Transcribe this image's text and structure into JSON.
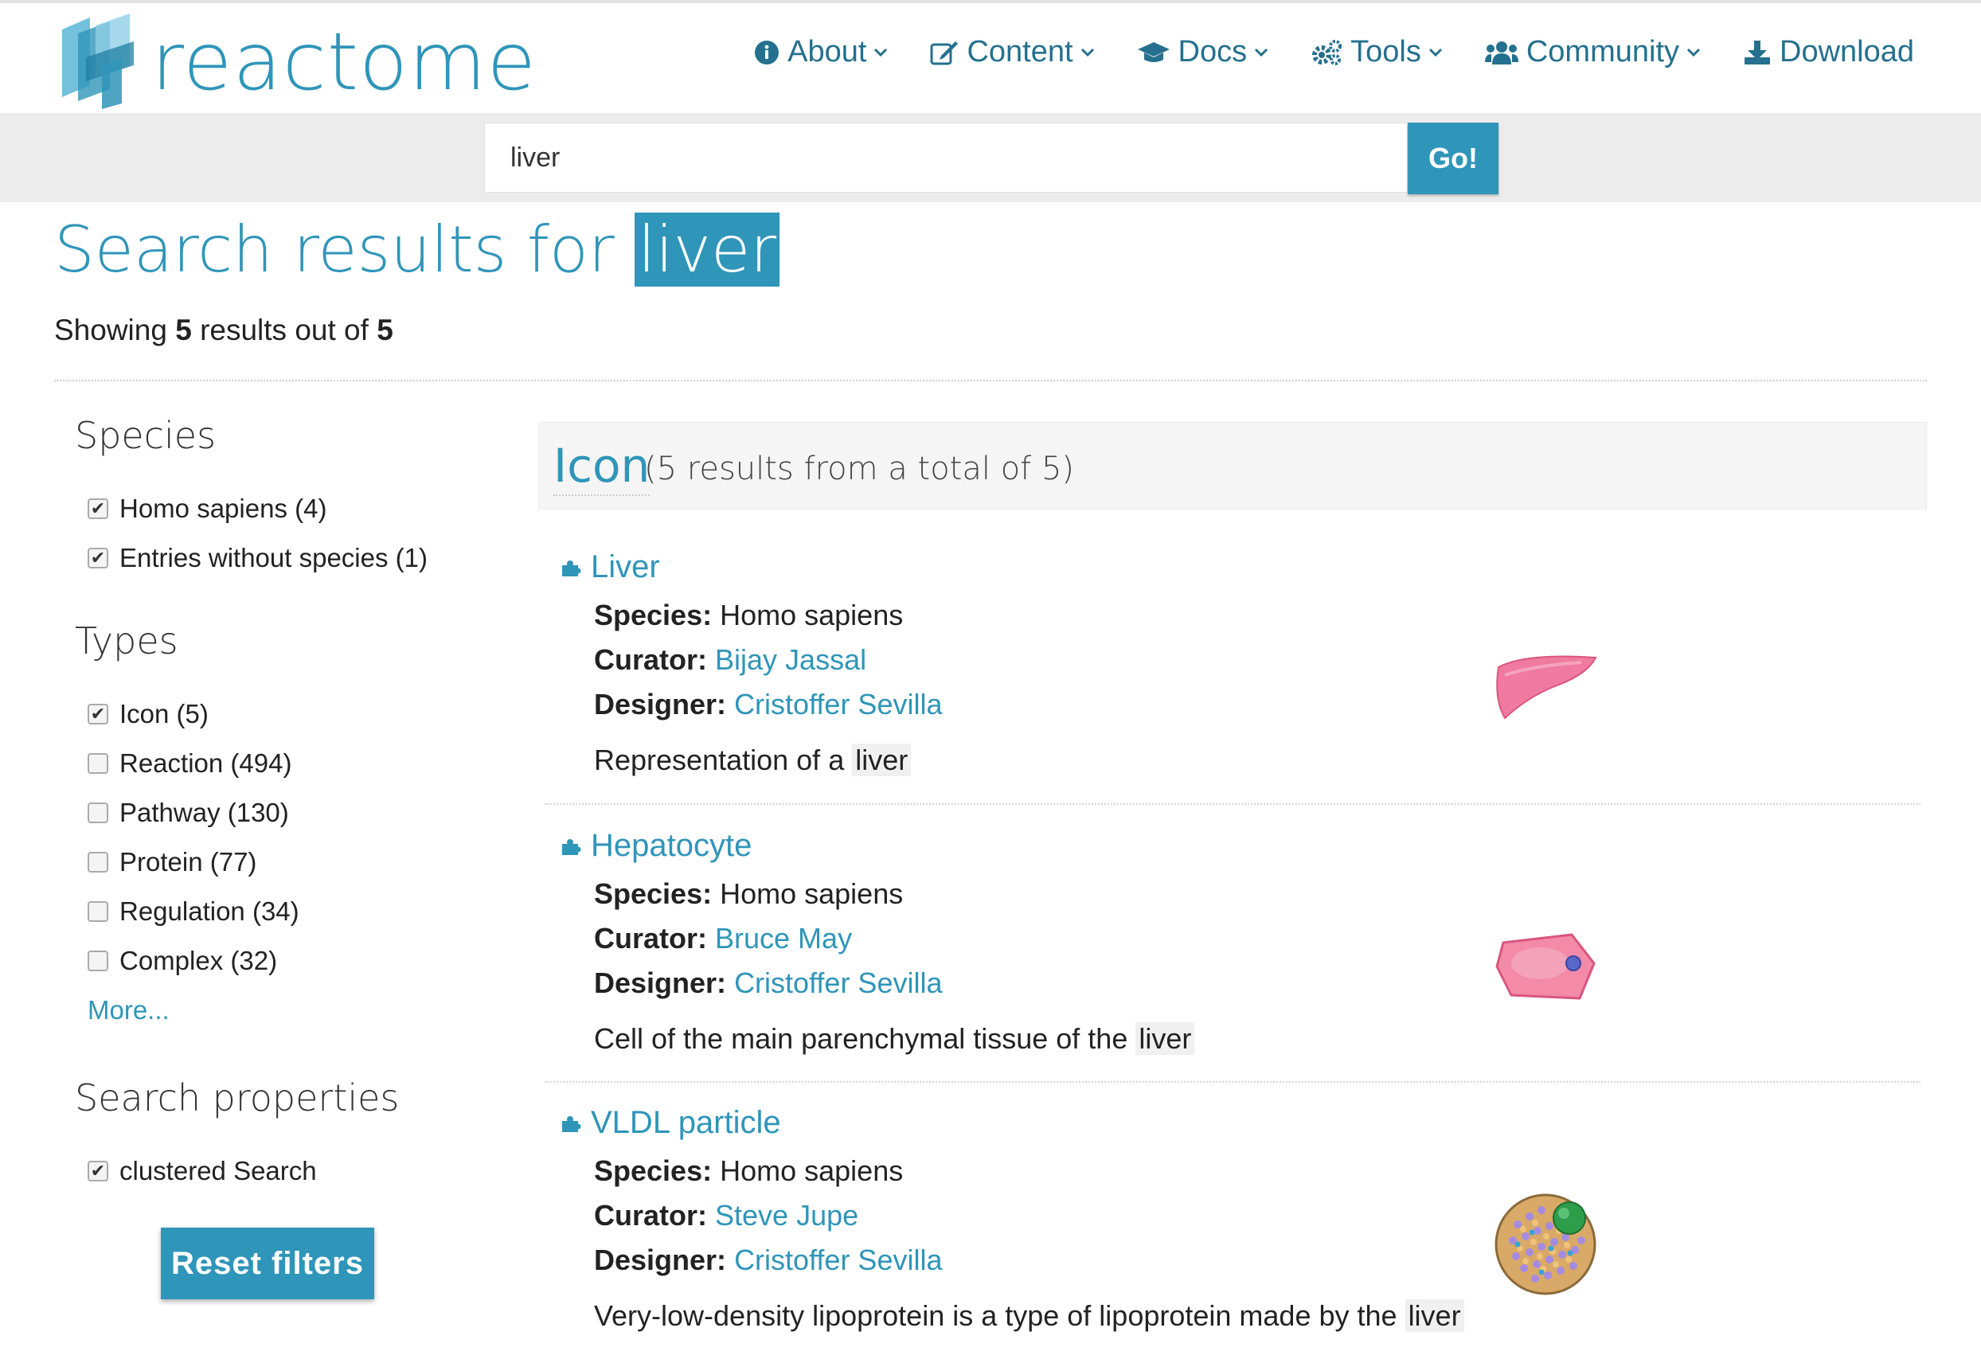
{
  "header": {
    "logo_text": "reactome",
    "nav": [
      {
        "label": "About",
        "icon": "info-circle-icon"
      },
      {
        "label": "Content",
        "icon": "edit-icon"
      },
      {
        "label": "Docs",
        "icon": "graduation-cap-icon"
      },
      {
        "label": "Tools",
        "icon": "cogs-icon"
      },
      {
        "label": "Community",
        "icon": "users-icon"
      },
      {
        "label": "Download",
        "icon": "download-icon"
      }
    ]
  },
  "search": {
    "value": "liver",
    "button_label": "Go!"
  },
  "title": {
    "prefix": "Search results for",
    "query": "liver"
  },
  "showing": {
    "prefix": "Showing",
    "shown": "5",
    "middle": "results out of",
    "total": "5"
  },
  "facets": {
    "species_title": "Species",
    "species": [
      {
        "label": "Homo sapiens (4)",
        "checked": true
      },
      {
        "label": "Entries without species (1)",
        "checked": true
      }
    ],
    "types_title": "Types",
    "types": [
      {
        "label": "Icon (5)",
        "checked": true
      },
      {
        "label": "Reaction (494)",
        "checked": false
      },
      {
        "label": "Pathway (130)",
        "checked": false
      },
      {
        "label": "Protein (77)",
        "checked": false
      },
      {
        "label": "Regulation (34)",
        "checked": false
      },
      {
        "label": "Complex (32)",
        "checked": false
      }
    ],
    "more_label": "More...",
    "props_title": "Search properties",
    "props": [
      {
        "label": "clustered Search",
        "checked": true
      }
    ],
    "reset_label": "Reset filters"
  },
  "results_header": {
    "kind": "Icon",
    "count_text": "(5 results from a total of 5)"
  },
  "labels": {
    "species": "Species:",
    "curator": "Curator:",
    "designer": "Designer:"
  },
  "results": [
    {
      "title": "Liver",
      "species": "Homo sapiens",
      "curator": "Bijay Jassal",
      "designer": "Cristoffer Sevilla",
      "desc_prefix": "Representation of a",
      "desc_highlight": "liver",
      "image": "liver-icon"
    },
    {
      "title": "Hepatocyte",
      "species": "Homo sapiens",
      "curator": "Bruce May",
      "designer": "Cristoffer Sevilla",
      "desc_prefix": "Cell of the main parenchymal tissue of the",
      "desc_highlight": "liver",
      "image": "hepatocyte-icon"
    },
    {
      "title": "VLDL particle",
      "species": "Homo sapiens",
      "curator": "Steve Jupe",
      "designer": "Cristoffer Sevilla",
      "desc_prefix": "Very-low-density lipoprotein is a type of lipoprotein made by the",
      "desc_highlight": "liver",
      "image": "vldl-particle-icon"
    }
  ],
  "colors": {
    "accent": "#2f95b9",
    "nav_text": "#24708e",
    "search_strip": "#ececec"
  }
}
